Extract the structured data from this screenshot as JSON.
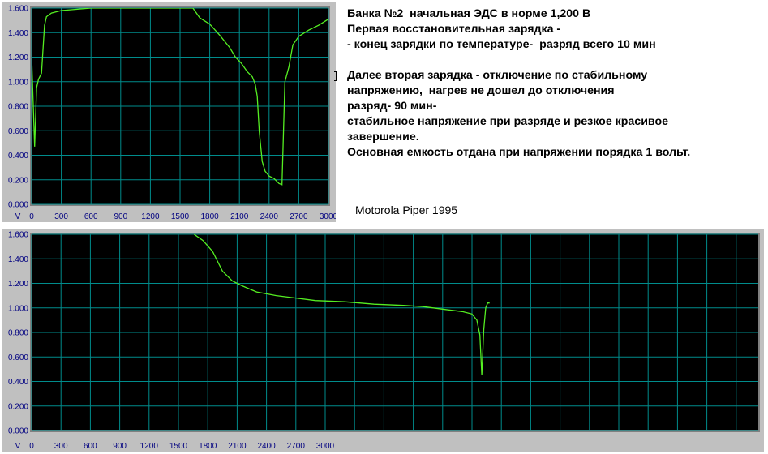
{
  "notes": {
    "lines": [
      "Банка №2  начальная ЭДС в норме 1,200 В",
      "Первая восстановительная зарядка -",
      "- конец зарядки по температуре-  разряд всего 10 мин",
      "",
      "Далее вторая зарядка - отключение по стабильному",
      "напряжению,  нагрев не дошел до отключения",
      "разряд- 90 мин-",
      "стабильное напряжение при разряде и резкое красивое",
      "завершение.",
      "Основная емкость отдана при напряжении порядка 1 вольт."
    ]
  },
  "caption": "Motorola Piper 1995",
  "colors": {
    "plot_background": "#000000",
    "grid": "#008c8c",
    "series": "#55ee22",
    "frame": "#c0c0c0",
    "tick_text": "#000080"
  },
  "chart_data": [
    {
      "type": "line",
      "ylabel": "V",
      "grid": true,
      "xlim": [
        0,
        3000
      ],
      "ylim": [
        0,
        1.6
      ],
      "x_ticks": [
        "0",
        "300",
        "600",
        "900",
        "1200",
        "1500",
        "1800",
        "2100",
        "2400",
        "2700",
        "3000"
      ],
      "y_ticks": [
        "0.000",
        "0.200",
        "0.400",
        "0.600",
        "0.800",
        "1.000",
        "1.200",
        "1.400",
        "1.600"
      ],
      "series": [
        {
          "x": [
            0,
            30,
            50,
            70,
            100,
            130,
            150,
            200,
            300,
            450,
            600,
            700,
            900,
            1200,
            1500,
            1630,
            1700,
            1800,
            1900,
            2000,
            2060,
            2120,
            2180,
            2230,
            2260,
            2280,
            2300,
            2330,
            2360,
            2400,
            2450,
            2500,
            2530,
            2560,
            2600,
            2640,
            2700,
            2800,
            2900,
            3000
          ],
          "y": [
            1.21,
            0.47,
            0.95,
            1.02,
            1.07,
            1.46,
            1.53,
            1.56,
            1.58,
            1.59,
            1.6,
            1.6,
            1.6,
            1.6,
            1.6,
            1.6,
            1.52,
            1.47,
            1.38,
            1.28,
            1.2,
            1.15,
            1.08,
            1.04,
            0.98,
            0.88,
            0.6,
            0.35,
            0.27,
            0.23,
            0.21,
            0.17,
            0.16,
            1.0,
            1.12,
            1.3,
            1.37,
            1.42,
            1.46,
            1.51
          ]
        }
      ]
    },
    {
      "type": "line",
      "ylabel": "V",
      "grid": true,
      "xlim": [
        0,
        3000
      ],
      "ylim": [
        0,
        1.6
      ],
      "x_ticks": [
        "0",
        "300",
        "600",
        "900",
        "1200",
        "1500",
        "1800",
        "2100",
        "2400",
        "2700",
        "3000"
      ],
      "y_ticks": [
        "0.000",
        "0.200",
        "0.400",
        "0.600",
        "0.800",
        "1.000",
        "1.200",
        "1.400",
        "1.600"
      ],
      "series": [
        {
          "x": [
            1660,
            1750,
            1850,
            1950,
            2050,
            2150,
            2300,
            2500,
            2700,
            2900,
            3200,
            3500,
            3800,
            4000,
            4200,
            4400,
            4500,
            4550,
            4580,
            4600,
            4620,
            4640,
            4660,
            4680
          ],
          "y": [
            1.6,
            1.55,
            1.46,
            1.3,
            1.22,
            1.18,
            1.13,
            1.1,
            1.08,
            1.06,
            1.05,
            1.03,
            1.02,
            1.01,
            0.99,
            0.97,
            0.95,
            0.9,
            0.78,
            0.45,
            0.82,
            1.0,
            1.04,
            1.04
          ]
        }
      ]
    }
  ]
}
